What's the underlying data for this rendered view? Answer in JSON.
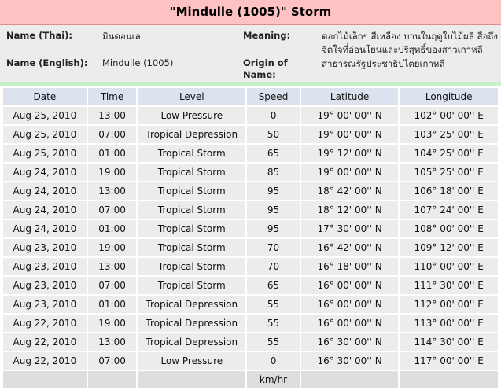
{
  "title": "\"Mindulle (1005)\" Storm",
  "info": {
    "name_thai_label": "Name (Thai):",
    "name_thai_value": "มินดอนเล",
    "name_english_label": "Name (English):",
    "name_english_value": "Mindulle (1005)",
    "meaning_label": "Meaning:",
    "meaning_value": "ดอกไม้เล็กๆ สีเหลือง บานในฤดูใบไม้ผลิ สื่อถึงจิตใจที่อ่อนโยนและบริสุทธิ์ของสาวเกาหลี",
    "origin_label_line1": "Origin of",
    "origin_label_line2": "Name:",
    "origin_value": "สาธารณรัฐประชาธิปไตยเกาหลี"
  },
  "table": {
    "headers": [
      "Date",
      "Time",
      "Level",
      "Speed",
      "Latitude",
      "Longitude"
    ],
    "rows": [
      [
        "Aug 25, 2010",
        "13:00",
        "Low Pressure",
        "0",
        "19° 00' 00'' N",
        "102° 00' 00'' E"
      ],
      [
        "Aug 25, 2010",
        "07:00",
        "Tropical Depression",
        "50",
        "19° 00' 00'' N",
        "103° 25' 00'' E"
      ],
      [
        "Aug 25, 2010",
        "01:00",
        "Tropical Storm",
        "65",
        "19° 12' 00'' N",
        "104° 25' 00'' E"
      ],
      [
        "Aug 24, 2010",
        "19:00",
        "Tropical Storm",
        "85",
        "19° 00' 00'' N",
        "105° 25' 00'' E"
      ],
      [
        "Aug 24, 2010",
        "13:00",
        "Tropical Storm",
        "95",
        "18° 42' 00'' N",
        "106° 18' 00'' E"
      ],
      [
        "Aug 24, 2010",
        "07:00",
        "Tropical Storm",
        "95",
        "18° 12' 00'' N",
        "107° 24' 00'' E"
      ],
      [
        "Aug 24, 2010",
        "01:00",
        "Tropical Storm",
        "95",
        "17° 30' 00'' N",
        "108° 00' 00'' E"
      ],
      [
        "Aug 23, 2010",
        "19:00",
        "Tropical Storm",
        "70",
        "16° 42' 00'' N",
        "109° 12' 00'' E"
      ],
      [
        "Aug 23, 2010",
        "13:00",
        "Tropical Storm",
        "70",
        "16° 18' 00'' N",
        "110° 00' 00'' E"
      ],
      [
        "Aug 23, 2010",
        "07:00",
        "Tropical Storm",
        "65",
        "16° 00' 00'' N",
        "111° 30' 00'' E"
      ],
      [
        "Aug 23, 2010",
        "01:00",
        "Tropical Depression",
        "55",
        "16° 00' 00'' N",
        "112° 00' 00'' E"
      ],
      [
        "Aug 22, 2010",
        "19:00",
        "Tropical Depression",
        "55",
        "16° 00' 00'' N",
        "113° 00' 00'' E"
      ],
      [
        "Aug 22, 2010",
        "13:00",
        "Tropical Depression",
        "55",
        "16° 30' 00'' N",
        "114° 30' 00'' E"
      ],
      [
        "Aug 22, 2010",
        "07:00",
        "Low Pressure",
        "0",
        "16° 30' 00'' N",
        "117° 00' 00'' E"
      ]
    ],
    "footer": [
      "",
      "",
      "",
      "km/hr",
      "",
      ""
    ]
  }
}
